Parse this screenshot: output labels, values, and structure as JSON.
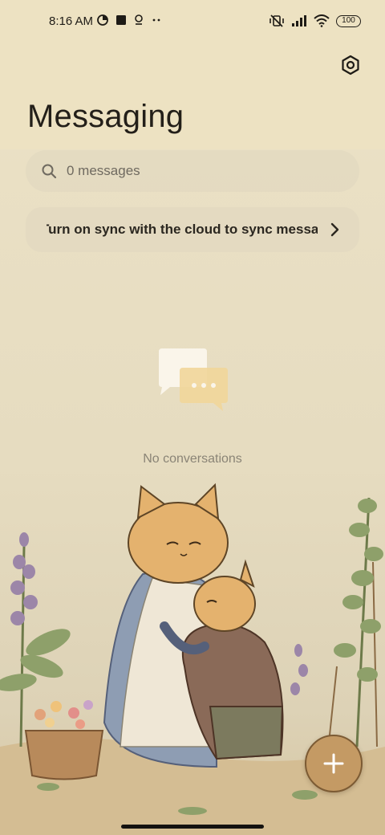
{
  "status_bar": {
    "time": "8:16 AM",
    "left_icons": [
      "data-saver-icon",
      "stop-square-icon",
      "location-pin-icon",
      "more-dots-icon"
    ],
    "right_icons": [
      "vibrate-mute-icon",
      "signal-bars-icon",
      "wifi-icon"
    ],
    "battery": "100"
  },
  "header": {
    "title": "Messaging",
    "settings_icon": "settings-hexagon-icon"
  },
  "search": {
    "placeholder": "0 messages"
  },
  "sync_banner": {
    "text": "Turn on sync with the cloud to sync messages"
  },
  "empty_state": {
    "text": "No conversations"
  },
  "fab": {
    "icon": "plus-icon"
  },
  "colors": {
    "header_bg": "#ede2c2",
    "accent": "#c49a64",
    "fab_border": "#7c5b34",
    "text_primary": "#231f19",
    "text_secondary": "#8a8476"
  }
}
